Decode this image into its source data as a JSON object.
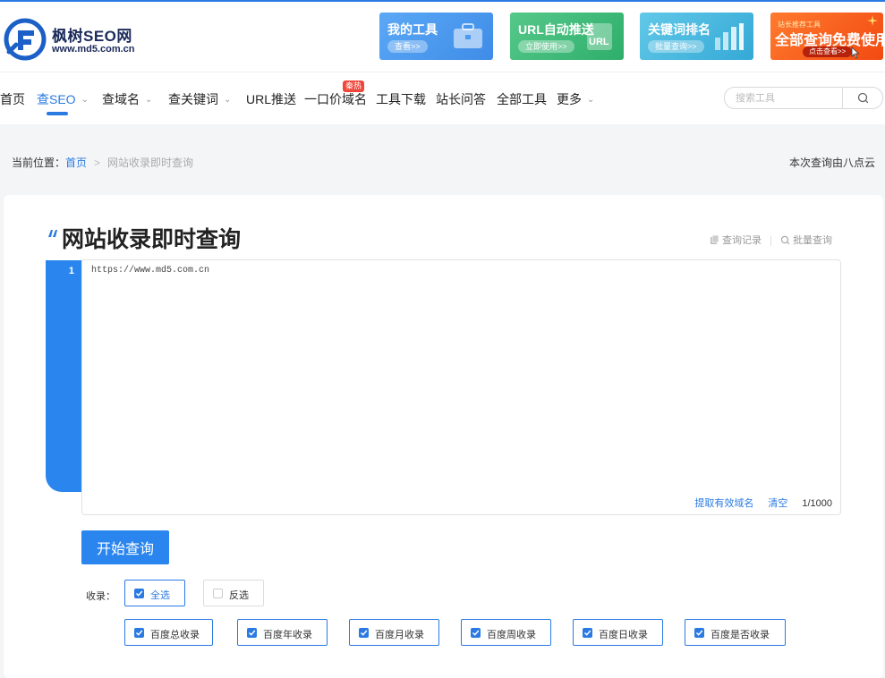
{
  "brand": {
    "name": "枫树SEO网",
    "url": "www.md5.com.cn"
  },
  "banners": [
    {
      "title": "我的工具",
      "button": "查看>>",
      "icon": "toolbox-icon",
      "color": "#4a9af0"
    },
    {
      "title": "URL自动推送",
      "button": "立即使用>>",
      "icon": "url-icon",
      "color": "#3dba78"
    },
    {
      "title": "关键词排名",
      "button": "批量查询>>",
      "icon": "bar-chart-icon",
      "color": "#45b6de"
    },
    {
      "small": "站长推荐工具",
      "title": "全部查询免费使用",
      "button": "点击查看>>",
      "icon": "pointer-icon",
      "color": "#f55a1c"
    }
  ],
  "nav": {
    "items": [
      {
        "label": "首页"
      },
      {
        "label": "查SEO",
        "active": true
      },
      {
        "label": "查域名"
      },
      {
        "label": "查关键词"
      },
      {
        "label": "URL推送"
      },
      {
        "label": "一口价域名",
        "badge": "秦热"
      },
      {
        "label": "工具下载"
      },
      {
        "label": "站长问答"
      },
      {
        "label": "全部工具"
      },
      {
        "label": "更多"
      }
    ],
    "search_placeholder": "搜索工具"
  },
  "breadcrumb": {
    "prefix": "当前位置：",
    "home": "首页",
    "current": "网站收录即时查询"
  },
  "provider_note": "本次查询由八点云",
  "page": {
    "title": "网站收录即时查询",
    "history_link": "查询记录",
    "batch_link": "批量查询"
  },
  "editor": {
    "line_number": "1",
    "value": "https://www.md5.com.cn",
    "extract_link": "提取有效域名",
    "clear_link": "清空",
    "counter": "1/1000"
  },
  "start_button": "开始查询",
  "options": {
    "label": "收录：",
    "select_all": {
      "label": "全选",
      "checked": true
    },
    "invert": {
      "label": "反选",
      "checked": false
    },
    "items": [
      {
        "label": "百度总收录",
        "checked": true
      },
      {
        "label": "百度年收录",
        "checked": true
      },
      {
        "label": "百度月收录",
        "checked": true
      },
      {
        "label": "百度周收录",
        "checked": true
      },
      {
        "label": "百度日收录",
        "checked": true
      },
      {
        "label": "百度是否收录",
        "checked": true
      }
    ]
  },
  "colors": {
    "accent": "#2a7ae2",
    "hot_badge": "#f0463a"
  }
}
